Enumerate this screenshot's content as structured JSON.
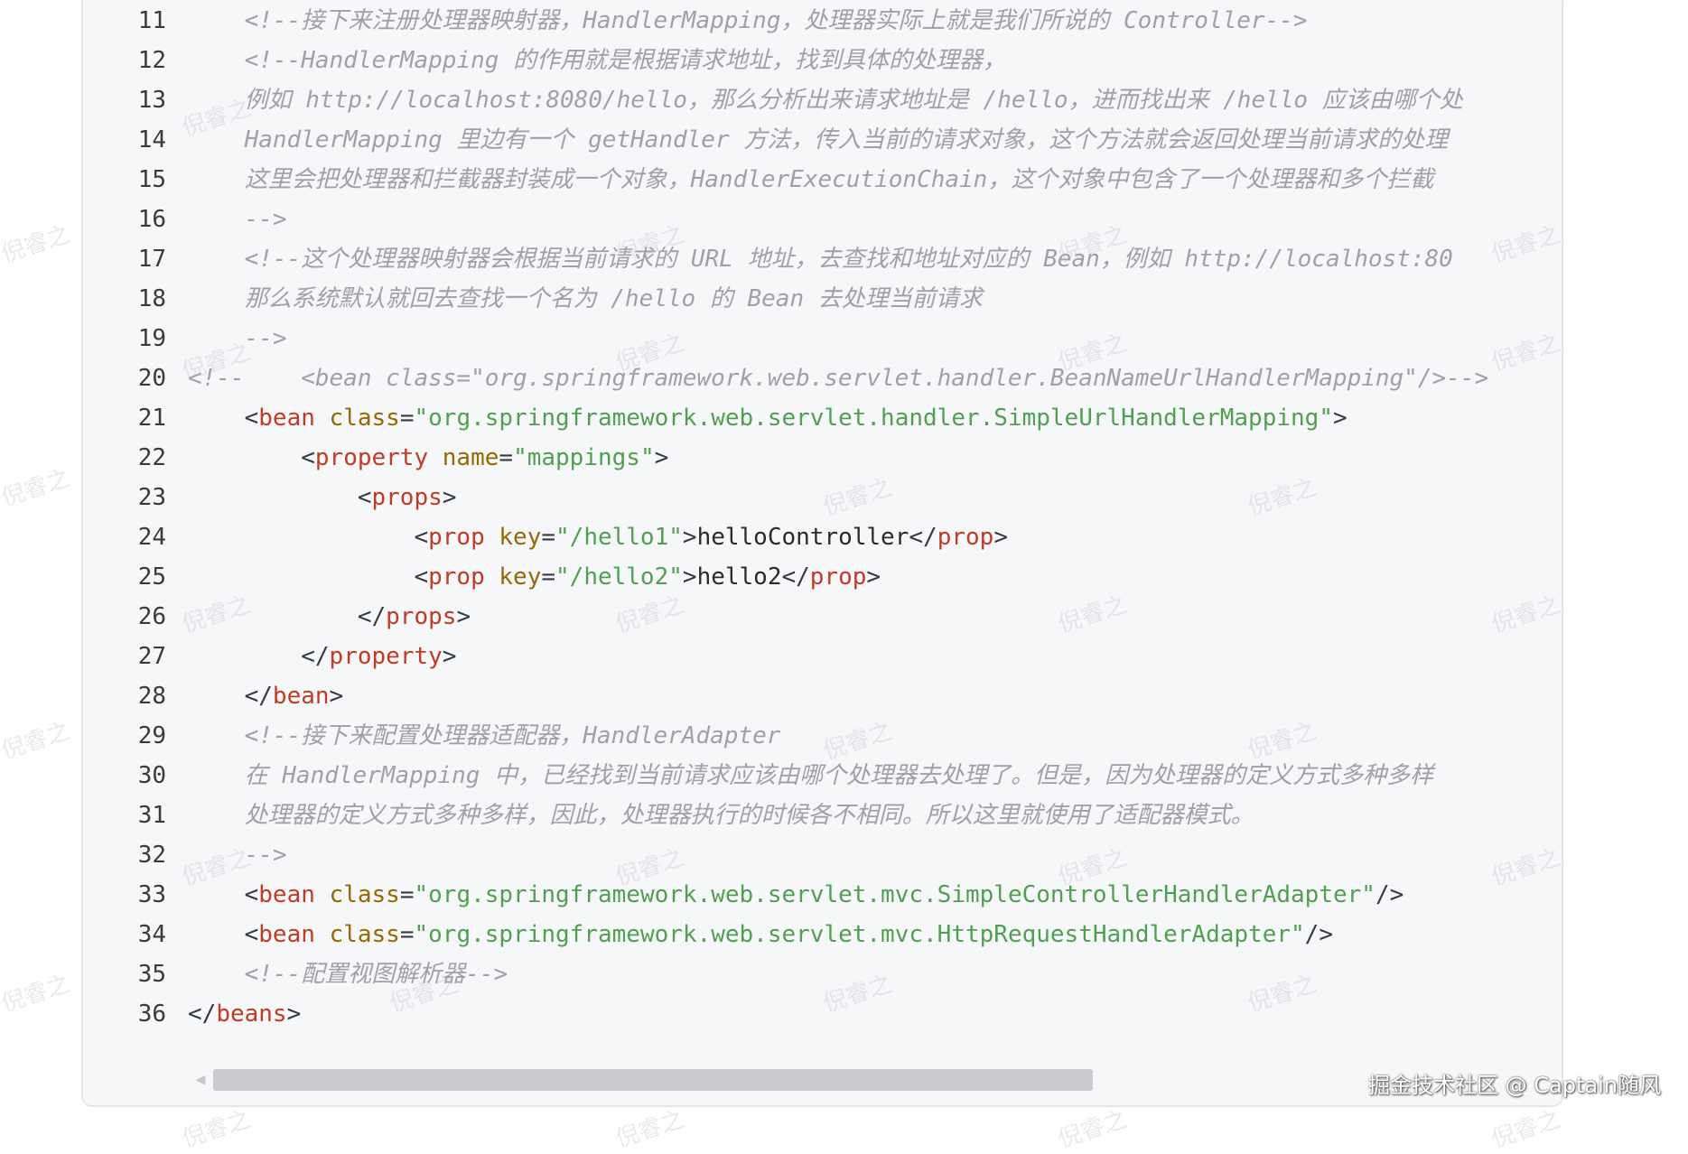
{
  "code_block": {
    "lines": [
      {
        "no": "11",
        "tokens": [
          {
            "t": "    <!--接下来注册处理器映射器，HandlerMapping，处理器实际上就是我们所说的 Controller-->",
            "k": "comment"
          }
        ]
      },
      {
        "no": "12",
        "tokens": [
          {
            "t": "    <!--HandlerMapping 的作用就是根据请求地址，找到具体的处理器，",
            "k": "comment"
          }
        ]
      },
      {
        "no": "13",
        "tokens": [
          {
            "t": "    例如 http://localhost:8080/hello，那么分析出来请求地址是 /hello，进而找出来 /hello 应该由哪个处",
            "k": "comment"
          }
        ]
      },
      {
        "no": "14",
        "tokens": [
          {
            "t": "    HandlerMapping 里边有一个 getHandler 方法，传入当前的请求对象，这个方法就会返回处理当前请求的处理",
            "k": "comment"
          }
        ]
      },
      {
        "no": "15",
        "tokens": [
          {
            "t": "    这里会把处理器和拦截器封装成一个对象，HandlerExecutionChain，这个对象中包含了一个处理器和多个拦截",
            "k": "comment"
          }
        ]
      },
      {
        "no": "16",
        "tokens": [
          {
            "t": "    -->",
            "k": "comment"
          }
        ]
      },
      {
        "no": "17",
        "tokens": [
          {
            "t": "    <!--这个处理器映射器会根据当前请求的 URL 地址，去查找和地址对应的 Bean，例如 http://localhost:80",
            "k": "comment"
          }
        ]
      },
      {
        "no": "18",
        "tokens": [
          {
            "t": "    那么系统默认就回去查找一个名为 /hello 的 Bean 去处理当前请求",
            "k": "comment"
          }
        ]
      },
      {
        "no": "19",
        "tokens": [
          {
            "t": "    -->",
            "k": "comment"
          }
        ]
      },
      {
        "no": "20",
        "tokens": [
          {
            "t": "<!--    <bean class=\"org.springframework.web.servlet.handler.BeanNameUrlHandlerMapping\"/>-->",
            "k": "comment"
          }
        ]
      },
      {
        "no": "21",
        "tokens": [
          {
            "t": "    <",
            "k": "punct"
          },
          {
            "t": "bean",
            "k": "tag"
          },
          {
            "t": " ",
            "k": "text"
          },
          {
            "t": "class",
            "k": "attr"
          },
          {
            "t": "=",
            "k": "punct"
          },
          {
            "t": "\"org.springframework.web.servlet.handler.SimpleUrlHandlerMapping\"",
            "k": "str"
          },
          {
            "t": ">",
            "k": "punct"
          }
        ]
      },
      {
        "no": "22",
        "tokens": [
          {
            "t": "        <",
            "k": "punct"
          },
          {
            "t": "property",
            "k": "tag"
          },
          {
            "t": " ",
            "k": "text"
          },
          {
            "t": "name",
            "k": "attr"
          },
          {
            "t": "=",
            "k": "punct"
          },
          {
            "t": "\"mappings\"",
            "k": "str"
          },
          {
            "t": ">",
            "k": "punct"
          }
        ]
      },
      {
        "no": "23",
        "tokens": [
          {
            "t": "            <",
            "k": "punct"
          },
          {
            "t": "props",
            "k": "tag"
          },
          {
            "t": ">",
            "k": "punct"
          }
        ]
      },
      {
        "no": "24",
        "tokens": [
          {
            "t": "                <",
            "k": "punct"
          },
          {
            "t": "prop",
            "k": "tag"
          },
          {
            "t": " ",
            "k": "text"
          },
          {
            "t": "key",
            "k": "attr"
          },
          {
            "t": "=",
            "k": "punct"
          },
          {
            "t": "\"/hello1\"",
            "k": "str"
          },
          {
            "t": ">",
            "k": "punct"
          },
          {
            "t": "helloController",
            "k": "text"
          },
          {
            "t": "</",
            "k": "punct"
          },
          {
            "t": "prop",
            "k": "tag"
          },
          {
            "t": ">",
            "k": "punct"
          }
        ]
      },
      {
        "no": "25",
        "tokens": [
          {
            "t": "                <",
            "k": "punct"
          },
          {
            "t": "prop",
            "k": "tag"
          },
          {
            "t": " ",
            "k": "text"
          },
          {
            "t": "key",
            "k": "attr"
          },
          {
            "t": "=",
            "k": "punct"
          },
          {
            "t": "\"/hello2\"",
            "k": "str"
          },
          {
            "t": ">",
            "k": "punct"
          },
          {
            "t": "hello2",
            "k": "text"
          },
          {
            "t": "</",
            "k": "punct"
          },
          {
            "t": "prop",
            "k": "tag"
          },
          {
            "t": ">",
            "k": "punct"
          }
        ]
      },
      {
        "no": "26",
        "tokens": [
          {
            "t": "            </",
            "k": "punct"
          },
          {
            "t": "props",
            "k": "tag"
          },
          {
            "t": ">",
            "k": "punct"
          }
        ]
      },
      {
        "no": "27",
        "tokens": [
          {
            "t": "        </",
            "k": "punct"
          },
          {
            "t": "property",
            "k": "tag"
          },
          {
            "t": ">",
            "k": "punct"
          }
        ]
      },
      {
        "no": "28",
        "tokens": [
          {
            "t": "    </",
            "k": "punct"
          },
          {
            "t": "bean",
            "k": "tag"
          },
          {
            "t": ">",
            "k": "punct"
          }
        ]
      },
      {
        "no": "29",
        "tokens": [
          {
            "t": "    <!--接下来配置处理器适配器，HandlerAdapter",
            "k": "comment"
          }
        ]
      },
      {
        "no": "30",
        "tokens": [
          {
            "t": "    在 HandlerMapping 中，已经找到当前请求应该由哪个处理器去处理了。但是，因为处理器的定义方式多种多样",
            "k": "comment"
          }
        ]
      },
      {
        "no": "31",
        "tokens": [
          {
            "t": "    处理器的定义方式多种多样，因此，处理器执行的时候各不相同。所以这里就使用了适配器模式。",
            "k": "comment"
          }
        ]
      },
      {
        "no": "32",
        "tokens": [
          {
            "t": "    -->",
            "k": "comment"
          }
        ]
      },
      {
        "no": "33",
        "tokens": [
          {
            "t": "    <",
            "k": "punct"
          },
          {
            "t": "bean",
            "k": "tag"
          },
          {
            "t": " ",
            "k": "text"
          },
          {
            "t": "class",
            "k": "attr"
          },
          {
            "t": "=",
            "k": "punct"
          },
          {
            "t": "\"org.springframework.web.servlet.mvc.SimpleControllerHandlerAdapter\"",
            "k": "str"
          },
          {
            "t": "/>",
            "k": "punct"
          }
        ]
      },
      {
        "no": "34",
        "tokens": [
          {
            "t": "    <",
            "k": "punct"
          },
          {
            "t": "bean",
            "k": "tag"
          },
          {
            "t": " ",
            "k": "text"
          },
          {
            "t": "class",
            "k": "attr"
          },
          {
            "t": "=",
            "k": "punct"
          },
          {
            "t": "\"org.springframework.web.servlet.mvc.HttpRequestHandlerAdapter\"",
            "k": "str"
          },
          {
            "t": "/>",
            "k": "punct"
          }
        ]
      },
      {
        "no": "35",
        "tokens": [
          {
            "t": "    <!--配置视图解析器-->",
            "k": "comment"
          }
        ]
      },
      {
        "no": "36",
        "tokens": [
          {
            "t": "</",
            "k": "punct"
          },
          {
            "t": "beans",
            "k": "tag"
          },
          {
            "t": ">",
            "k": "punct"
          }
        ]
      }
    ]
  },
  "scrollbar": {
    "arrow_icon": "scroll-left-arrow-icon",
    "thumb_fraction": 0.66
  },
  "footer": {
    "credit": "掘金技术社区 @ Captain随风"
  },
  "watermark": {
    "text": "倪睿之"
  }
}
